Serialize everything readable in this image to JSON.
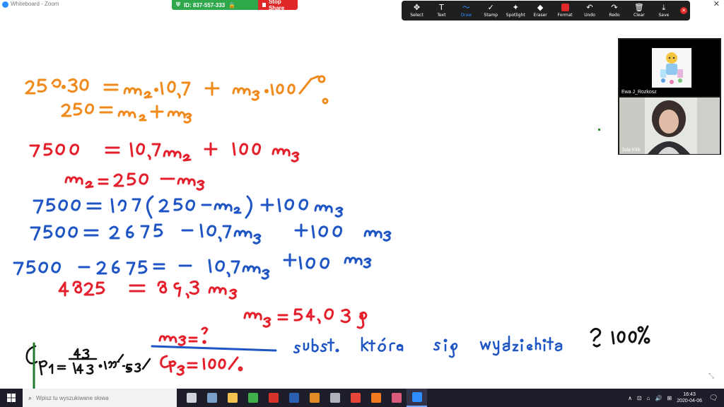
{
  "window": {
    "title": "Whiteboard - Zoom",
    "close_glyph": "✕"
  },
  "share_bar": {
    "meeting_id": "ID: 837-557-333",
    "stop_label": "Stop Share"
  },
  "toolbar": {
    "tools": [
      {
        "name": "select",
        "label": "Select",
        "icon": "✥",
        "icon_name": "move-arrows-icon"
      },
      {
        "name": "text",
        "label": "Text",
        "icon": "T",
        "icon_name": "text-icon"
      },
      {
        "name": "draw",
        "label": "Draw",
        "icon": "〜",
        "icon_name": "squiggle-icon",
        "active": true
      },
      {
        "name": "stamp",
        "label": "Stamp",
        "icon": "✓",
        "icon_name": "checkmark-icon"
      },
      {
        "name": "spotlight",
        "label": "Spotlight",
        "icon": "✦",
        "icon_name": "spotlight-icon"
      },
      {
        "name": "eraser",
        "label": "Eraser",
        "icon": "◆",
        "icon_name": "eraser-icon"
      },
      {
        "name": "format",
        "label": "Format",
        "icon": "",
        "icon_name": "color-swatch-icon"
      },
      {
        "name": "undo",
        "label": "Undo",
        "icon": "↶",
        "icon_name": "undo-icon"
      },
      {
        "name": "redo",
        "label": "Redo",
        "icon": "↷",
        "icon_name": "redo-icon"
      },
      {
        "name": "clear",
        "label": "Clear",
        "icon": "🗑",
        "icon_name": "trash-icon"
      },
      {
        "name": "save",
        "label": "Save",
        "icon": "⤓",
        "icon_name": "save-icon"
      }
    ],
    "close_glyph": "✕",
    "active_color": "#2d8cff",
    "format_color": "#e02828"
  },
  "participants": [
    {
      "name": "Ewa J_Rozkosz"
    },
    {
      "name": "Jula Kkk"
    }
  ],
  "whiteboard": {
    "colors": {
      "orange": "#f08a1c",
      "red": "#e3202c",
      "blue": "#1f56c4",
      "green": "#1f7a2c"
    },
    "lines": [
      {
        "id": "orange-line-1",
        "color": "orange",
        "text": "250·30 = m₂·10,7 + m₃·100%"
      },
      {
        "id": "orange-line-2",
        "color": "orange",
        "text": "250 = m₂ + m₃"
      },
      {
        "id": "red-line-1",
        "color": "red",
        "text": "7500 = 10,7m₂ + 100 m₃"
      },
      {
        "id": "red-line-2",
        "color": "red",
        "text": "m₂ = 250 − m₃"
      },
      {
        "id": "blue-line-1",
        "color": "blue",
        "text": "7500 = 10,7(250 − m₃) + 100m₃"
      },
      {
        "id": "blue-line-2",
        "color": "blue",
        "text": "7500 = 2675 − 10,7m₃ + 100 m₃"
      },
      {
        "id": "blue-line-3",
        "color": "blue",
        "text": "7500 − 2675 = − 10,7m₃ + 100 m₃"
      },
      {
        "id": "red-line-3",
        "color": "red",
        "text": "4825 = 89,3 m₃"
      },
      {
        "id": "red-line-4",
        "color": "red",
        "text": "m₃ = 54,03 g"
      },
      {
        "id": "black-line-cp1",
        "color": "black",
        "text": "Cp₁ = 43/143 · 100% · 53%"
      },
      {
        "id": "red-fraction-num",
        "color": "red",
        "text": "m₃ = ?"
      },
      {
        "id": "red-fraction-den",
        "color": "red",
        "text": "Cp₃ = 100%"
      },
      {
        "id": "blue-note",
        "color": "blue",
        "text": "subst. która się wydzieliła"
      },
      {
        "id": "black-note",
        "color": "black",
        "text": "? 100%"
      }
    ]
  },
  "taskbar": {
    "search_placeholder": "Wpisz tu wyszukiwane słowa",
    "apps": [
      {
        "name": "task-view",
        "color": "#cfd3da"
      },
      {
        "name": "app-chart",
        "color": "#7aa0c8"
      },
      {
        "name": "app-file-explorer",
        "color": "#f2c14e"
      },
      {
        "name": "app-green-bars",
        "color": "#3fb04a"
      },
      {
        "name": "app-pdf",
        "color": "#d8322b"
      },
      {
        "name": "app-word",
        "color": "#2b5fb3"
      },
      {
        "name": "app-settings",
        "color": "#e08b24"
      },
      {
        "name": "app-calculator",
        "color": "#b0b3bb"
      },
      {
        "name": "app-chrome",
        "color": "#e6453a"
      },
      {
        "name": "app-firefox",
        "color": "#f37a1f"
      },
      {
        "name": "app-paint",
        "color": "#d95a7a"
      },
      {
        "name": "app-zoom",
        "color": "#2d8cff",
        "active": true
      }
    ],
    "tray_chevron": "∧",
    "tray_icons": [
      "⊡",
      "⌂",
      "🔊",
      "⊞"
    ],
    "time": "16:43",
    "date": "2020-04-06",
    "notification_glyph": "🗨"
  }
}
